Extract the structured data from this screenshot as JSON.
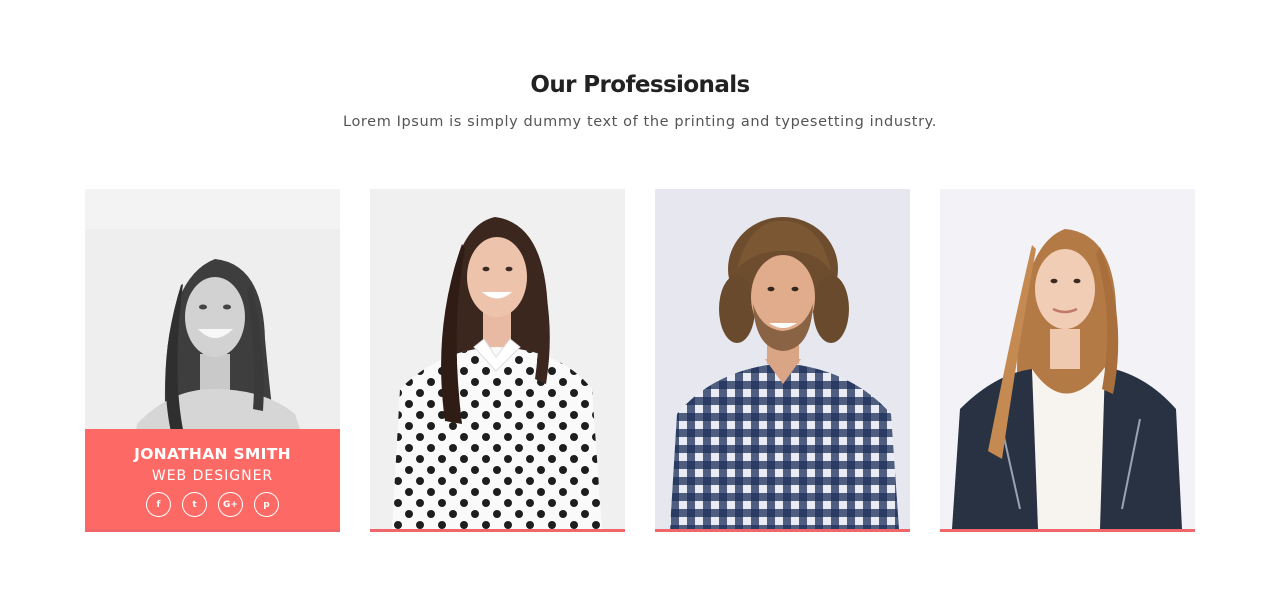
{
  "section": {
    "title": "Our Professionals",
    "subtitle": "Lorem Ipsum is simply dummy text of the printing and typesetting industry."
  },
  "colors": {
    "accent": "#fd6a65",
    "accent_border": "#f1666a"
  },
  "team": [
    {
      "name": "JONATHAN SMITH",
      "role": "WEB DESIGNER",
      "photo_style": "grayscale",
      "socials": [
        {
          "icon": "facebook-icon",
          "glyph": "f"
        },
        {
          "icon": "twitter-icon",
          "glyph": "t"
        },
        {
          "icon": "google-plus-icon",
          "glyph": "G+"
        },
        {
          "icon": "pinterest-icon",
          "glyph": "p"
        }
      ]
    },
    {
      "photo_style": "polka-dot-shirt"
    },
    {
      "photo_style": "plaid-shirt"
    },
    {
      "photo_style": "leather-jacket"
    }
  ]
}
